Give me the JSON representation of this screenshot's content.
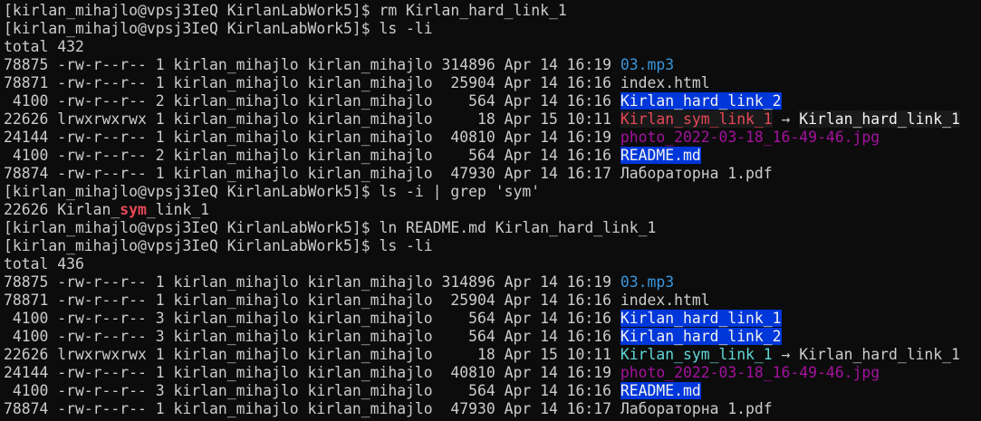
{
  "terminal": {
    "colors": {
      "background": "#0c0c0c",
      "foreground": "#cccccc",
      "dir_highlight": "#0037da",
      "audio": "#3a96dd",
      "broken_link": "#e74856",
      "symlink": "#61d6d6",
      "image": "#a3129e",
      "grep_match": "#e74856"
    },
    "lines": [
      [
        {
          "t": "[kirlan_mihajlo@vpsj3IeQ KirlanLabWork5]$ rm Kirlan_hard_link_1",
          "s": "norm"
        }
      ],
      [
        {
          "t": "[kirlan_mihajlo@vpsj3IeQ KirlanLabWork5]$ ls -li",
          "s": "norm"
        }
      ],
      [
        {
          "t": "total 432",
          "s": "norm"
        }
      ],
      [
        {
          "t": "78875 -rw-r--r-- 1 kirlan_mihajlo kirlan_mihajlo 314896 Apr 14 16:19 ",
          "s": "norm"
        },
        {
          "t": "03.mp3",
          "s": "mp3"
        }
      ],
      [
        {
          "t": "78871 -rw-r--r-- 1 kirlan_mihajlo kirlan_mihajlo  25904 Apr 14 16:16 index.html",
          "s": "norm"
        }
      ],
      [
        {
          "t": " 4100 -rw-r--r-- 2 kirlan_mihajlo kirlan_mihajlo    564 Apr 14 16:16 ",
          "s": "norm"
        },
        {
          "t": "Kirlan_hard_link_2",
          "s": "hl"
        }
      ],
      [
        {
          "t": "22626 lrwxrwxrwx 1 kirlan_mihajlo kirlan_mihajlo     18 Apr 15 10:11 ",
          "s": "norm"
        },
        {
          "t": "Kirlan_sym_link_1",
          "s": "broken"
        },
        {
          "t": " → ",
          "s": "norm"
        },
        {
          "t": "Kirlan_hard_link_1",
          "s": "target-broken"
        }
      ],
      [
        {
          "t": "24144 -rw-r--r-- 1 kirlan_mihajlo kirlan_mihajlo  40810 Apr 14 16:19 ",
          "s": "norm"
        },
        {
          "t": "photo_2022-03-18_16-49-46.jpg",
          "s": "img"
        }
      ],
      [
        {
          "t": " 4100 -rw-r--r-- 2 kirlan_mihajlo kirlan_mihajlo    564 Apr 14 16:16 ",
          "s": "norm"
        },
        {
          "t": "README.md",
          "s": "hl"
        }
      ],
      [
        {
          "t": "78874 -rw-r--r-- 1 kirlan_mihajlo kirlan_mihajlo  47930 Apr 14 16:17 Лабораторна 1.pdf",
          "s": "norm"
        }
      ],
      [
        {
          "t": "[kirlan_mihajlo@vpsj3IeQ KirlanLabWork5]$ ls -i | grep 'sym'",
          "s": "norm"
        }
      ],
      [
        {
          "t": "22626 Kirlan_",
          "s": "norm"
        },
        {
          "t": "sym",
          "s": "match"
        },
        {
          "t": "_link_1",
          "s": "norm"
        }
      ],
      [
        {
          "t": "[kirlan_mihajlo@vpsj3IeQ KirlanLabWork5]$ ln README.md Kirlan_hard_link_1",
          "s": "norm"
        }
      ],
      [
        {
          "t": "[kirlan_mihajlo@vpsj3IeQ KirlanLabWork5]$ ls -li",
          "s": "norm"
        }
      ],
      [
        {
          "t": "total 436",
          "s": "norm"
        }
      ],
      [
        {
          "t": "78875 -rw-r--r-- 1 kirlan_mihajlo kirlan_mihajlo 314896 Apr 14 16:19 ",
          "s": "norm"
        },
        {
          "t": "03.mp3",
          "s": "mp3"
        }
      ],
      [
        {
          "t": "78871 -rw-r--r-- 1 kirlan_mihajlo kirlan_mihajlo  25904 Apr 14 16:16 index.html",
          "s": "norm"
        }
      ],
      [
        {
          "t": " 4100 -rw-r--r-- 3 kirlan_mihajlo kirlan_mihajlo    564 Apr 14 16:16 ",
          "s": "norm"
        },
        {
          "t": "Kirlan_hard_link_1",
          "s": "hl"
        }
      ],
      [
        {
          "t": " 4100 -rw-r--r-- 3 kirlan_mihajlo kirlan_mihajlo    564 Apr 14 16:16 ",
          "s": "norm"
        },
        {
          "t": "Kirlan_hard_link_2",
          "s": "hl"
        }
      ],
      [
        {
          "t": "22626 lrwxrwxrwx 1 kirlan_mihajlo kirlan_mihajlo     18 Apr 15 10:11 ",
          "s": "norm"
        },
        {
          "t": "Kirlan_sym_link_1",
          "s": "sym"
        },
        {
          "t": " → Kirlan_hard_link_1",
          "s": "norm"
        }
      ],
      [
        {
          "t": "24144 -rw-r--r-- 1 kirlan_mihajlo kirlan_mihajlo  40810 Apr 14 16:19 ",
          "s": "norm"
        },
        {
          "t": "photo_2022-03-18_16-49-46.jpg",
          "s": "img"
        }
      ],
      [
        {
          "t": " 4100 -rw-r--r-- 3 kirlan_mihajlo kirlan_mihajlo    564 Apr 14 16:16 ",
          "s": "norm"
        },
        {
          "t": "README.md",
          "s": "hl"
        }
      ],
      [
        {
          "t": "78874 -rw-r--r-- 1 kirlan_mihajlo kirlan_mihajlo  47930 Apr 14 16:17 Лабораторна 1.pdf",
          "s": "norm"
        }
      ]
    ]
  }
}
